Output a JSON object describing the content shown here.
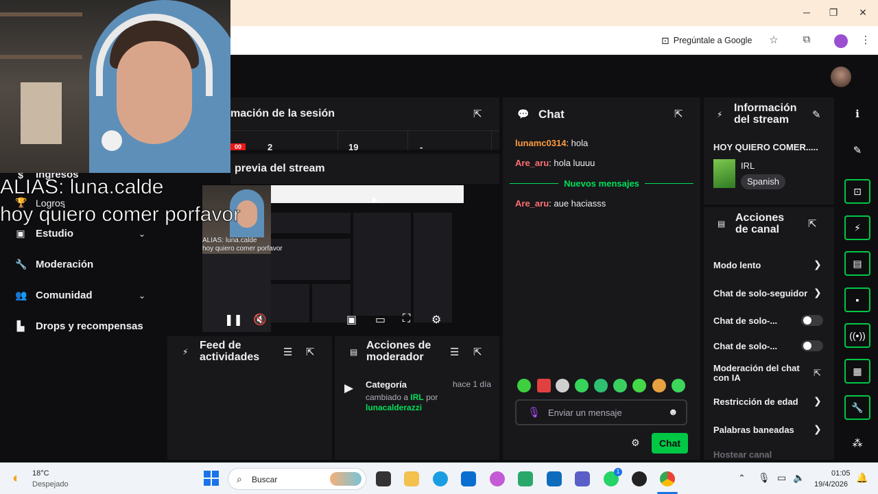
{
  "browser": {
    "ask_google": "Pregúntale a Google"
  },
  "sidebar": {
    "items": [
      {
        "label": "Ingresos"
      },
      {
        "label": "Logros"
      },
      {
        "label": "Estudio"
      },
      {
        "label": "Moderación"
      },
      {
        "label": "Comunidad"
      },
      {
        "label": "Drops y recompensas"
      }
    ]
  },
  "overlay": {
    "line1": "ALIAS: luna.calde",
    "line2": "hoy quiero comer porfavor"
  },
  "session": {
    "title": "mación de la sesión",
    "stats": [
      "2",
      "19",
      "-"
    ],
    "badge": "00"
  },
  "preview": {
    "title": "previa del stream",
    "mini_overlay_1": "ALIAS: luna.calde",
    "mini_overlay_2": "hoy quiero comer porfavor"
  },
  "activity_feed": {
    "title_1": "Feed de",
    "title_2": "actividades"
  },
  "mod_actions": {
    "title_1": "Acciones de",
    "title_2": "moderador",
    "event_title": "Categoría",
    "event_time": "hace 1 día",
    "event_text_1": "cambiado a",
    "event_category": "IRL",
    "event_text_2": "por",
    "event_user": "lunacalderazzi"
  },
  "chat": {
    "title": "Chat",
    "messages": [
      {
        "user": "lunamc0314",
        "text": ": hola",
        "color": "#ff9b3c"
      },
      {
        "user": "Are_aru",
        "text": ": hola luuuu",
        "color": "#ff6f6f"
      },
      {
        "user": "Are_aru",
        "text": ": aue haciasss",
        "color": "#ff6f6f"
      }
    ],
    "new_messages": "Nuevos mensajes",
    "input_placeholder": "Enviar un mensaje",
    "send_label": "Chat"
  },
  "stream_info": {
    "title_1": "Información",
    "title_2": "del stream",
    "stream_title": "HOY QUIERO COMER.....",
    "category": "IRL",
    "language": "Spanish"
  },
  "channel_actions": {
    "title_1": "Acciones",
    "title_2": "de canal",
    "items": [
      {
        "label": "Modo lento"
      },
      {
        "label": "Chat de solo-seguidor"
      },
      {
        "label": "Chat de solo-..."
      },
      {
        "label": "Chat de solo-..."
      },
      {
        "label": "Moderación del chat"
      },
      {
        "label": "con IA"
      },
      {
        "label": "Restricción de edad"
      },
      {
        "label": "Palabras baneadas"
      },
      {
        "label": "Hostear canal"
      }
    ]
  },
  "taskbar": {
    "weather_temp": "18°C",
    "weather_desc": "Despejado",
    "search_placeholder": "Buscar",
    "time": "01:05",
    "date": "19/4/2026",
    "chrome_badge": "1"
  },
  "colors": {
    "accent_green": "#00c845",
    "chat_green": "#00e05a",
    "panel_bg": "#18181b",
    "page_bg": "#0e0e10"
  }
}
